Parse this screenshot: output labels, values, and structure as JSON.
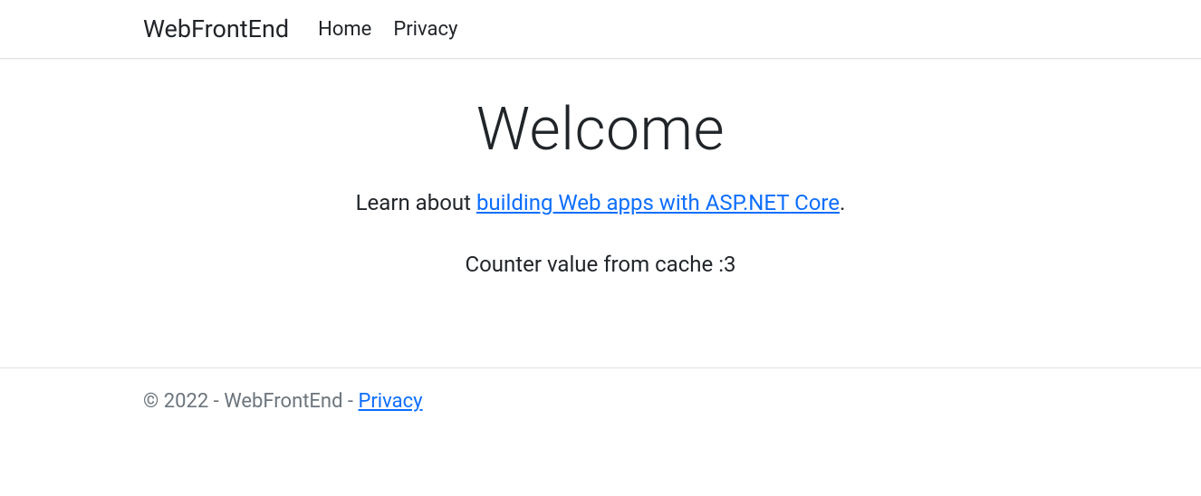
{
  "navbar": {
    "brand": "WebFrontEnd",
    "links": {
      "home": "Home",
      "privacy": "Privacy"
    }
  },
  "main": {
    "heading": "Welcome",
    "learn_prefix": "Learn about ",
    "learn_link": "building Web apps with ASP.NET Core",
    "learn_suffix": ".",
    "counter_label": "Counter value from cache :",
    "counter_value": "3"
  },
  "footer": {
    "copyright_prefix": "© 2022 - WebFrontEnd - ",
    "privacy_link": "Privacy"
  }
}
